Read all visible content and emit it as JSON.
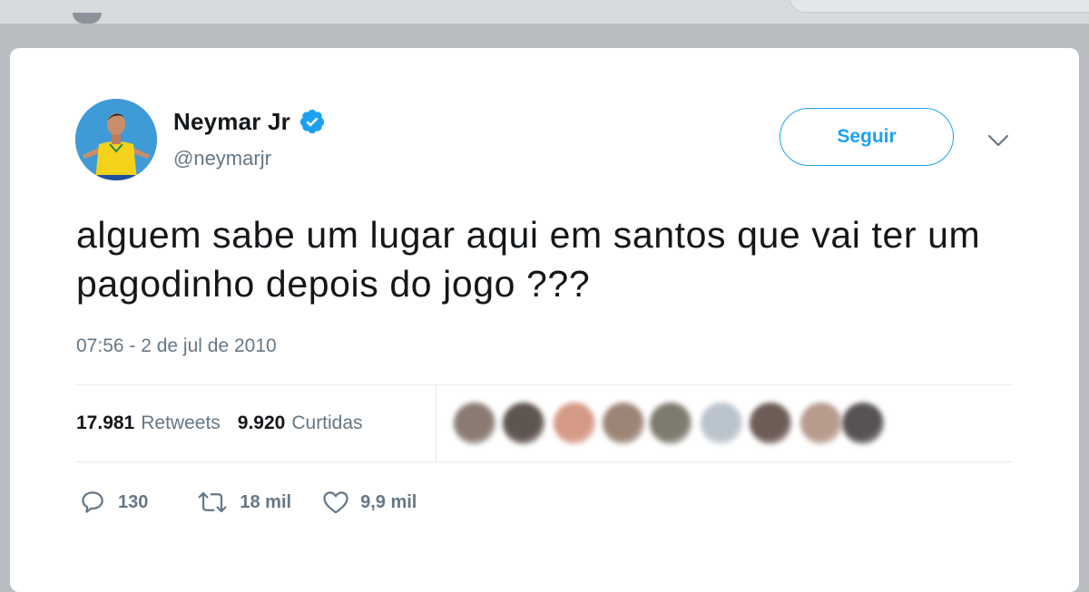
{
  "user": {
    "name": "Neymar Jr",
    "handle": "@neymarjr",
    "verified": true
  },
  "follow_button": {
    "label": "Seguir"
  },
  "tweet": {
    "text": "alguem sabe um lugar aqui em santos que vai ter um pagodinho depois do jogo ???",
    "timestamp": "07:56 - 2 de jul de 2010"
  },
  "stats": {
    "retweets_count": "17.981",
    "retweets_label": "Retweets",
    "likes_count": "9.920",
    "likes_label": "Curtidas"
  },
  "liker_avatars": [
    {
      "color": "#8a7a72"
    },
    {
      "color": "#5f5550"
    },
    {
      "color": "#d59a86"
    },
    {
      "color": "#9c8576"
    },
    {
      "color": "#7e7a6e"
    },
    {
      "color": "#b9c3cc"
    },
    {
      "color": "#6d5b55"
    },
    {
      "color": "#b79b8c"
    },
    {
      "color": "#585252"
    }
  ],
  "actions": {
    "replies": "130",
    "retweets": "18 mil",
    "likes": "9,9 mil"
  },
  "colors": {
    "accent": "#1da1f2",
    "text": "#14171a",
    "secondary": "#657786",
    "divider": "#e6ecf0"
  }
}
